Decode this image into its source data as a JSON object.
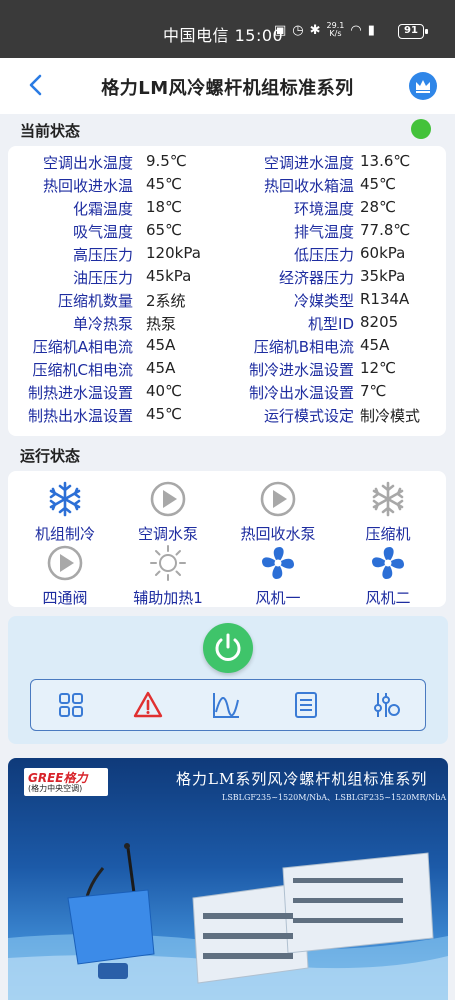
{
  "status_bar": {
    "carrier_time": "中国电信 15:00",
    "net_speed_top": "29.1",
    "net_speed_unit": "K/s",
    "battery": "91"
  },
  "nav": {
    "title": "格力LM风冷螺杆机组标准系列",
    "back_icon": "chevron-left-icon",
    "crown_icon": "crown-icon"
  },
  "current_status": {
    "title": "当前状态",
    "indicator_color": "#43c23a",
    "rows": [
      {
        "l1": "空调出水温度",
        "v1": "9.5℃",
        "l2": "空调进水温度",
        "v2": "13.6℃"
      },
      {
        "l1": "热回收进水温",
        "v1": "45℃",
        "l2": "热回收水箱温",
        "v2": "45℃"
      },
      {
        "l1": "化霜温度",
        "v1": "18℃",
        "l2": "环境温度",
        "v2": "28℃"
      },
      {
        "l1": "吸气温度",
        "v1": "65℃",
        "l2": "排气温度",
        "v2": "77.8℃"
      },
      {
        "l1": "高压压力",
        "v1": "120kPa",
        "l2": "低压压力",
        "v2": "60kPa"
      },
      {
        "l1": "油压压力",
        "v1": "45kPa",
        "l2": "经济器压力",
        "v2": "35kPa"
      },
      {
        "l1": "压缩机数量",
        "v1": "2系统",
        "l2": "冷媒类型",
        "v2": "R134A"
      },
      {
        "l1": "单冷热泵",
        "v1": "热泵",
        "l2": "机型ID",
        "v2": "8205"
      },
      {
        "l1": "压缩机A相电流",
        "v1": "45A",
        "l2": "压缩机B相电流",
        "v2": "45A"
      },
      {
        "l1": "压缩机C相电流",
        "v1": "45A",
        "l2": "制冷进水温设置",
        "v2": "12℃"
      },
      {
        "l1": "制热进水温设置",
        "v1": "40℃",
        "l2": "制冷出水温设置",
        "v2": "7℃"
      },
      {
        "l1": "制热出水温设置",
        "v1": "45℃",
        "l2": "运行模式设定",
        "v2": "制冷模式"
      }
    ]
  },
  "run_status": {
    "title": "运行状态",
    "items": [
      {
        "label": "机组制冷",
        "icon": "snowflake-icon",
        "active": true
      },
      {
        "label": "空调水泵",
        "icon": "pump-icon",
        "active": false
      },
      {
        "label": "热回收水泵",
        "icon": "pump-icon",
        "active": false
      },
      {
        "label": "压缩机",
        "icon": "snowflake-icon",
        "active": false
      },
      {
        "label": "四通阀",
        "icon": "pump-icon",
        "active": false
      },
      {
        "label": "辅助加热1",
        "icon": "sun-icon",
        "active": false
      },
      {
        "label": "风机一",
        "icon": "fan-icon",
        "active": true
      },
      {
        "label": "风机二",
        "icon": "fan-icon",
        "active": true
      }
    ]
  },
  "controls": {
    "power_icon": "power-icon",
    "power_color": "#3fc46a",
    "toolbar": [
      {
        "icon": "grid-icon"
      },
      {
        "icon": "warning-icon"
      },
      {
        "icon": "chart-icon"
      },
      {
        "icon": "list-icon"
      },
      {
        "icon": "sliders-icon"
      }
    ]
  },
  "banner": {
    "logo_top": "GREE格力",
    "logo_bottom": "(格力中央空调)",
    "title": "格力LM系列风冷螺杆机组标准系列",
    "subtitle": "LSBLGF235~1520M/NbA、LSBLGF235~1520MR/NbA"
  }
}
